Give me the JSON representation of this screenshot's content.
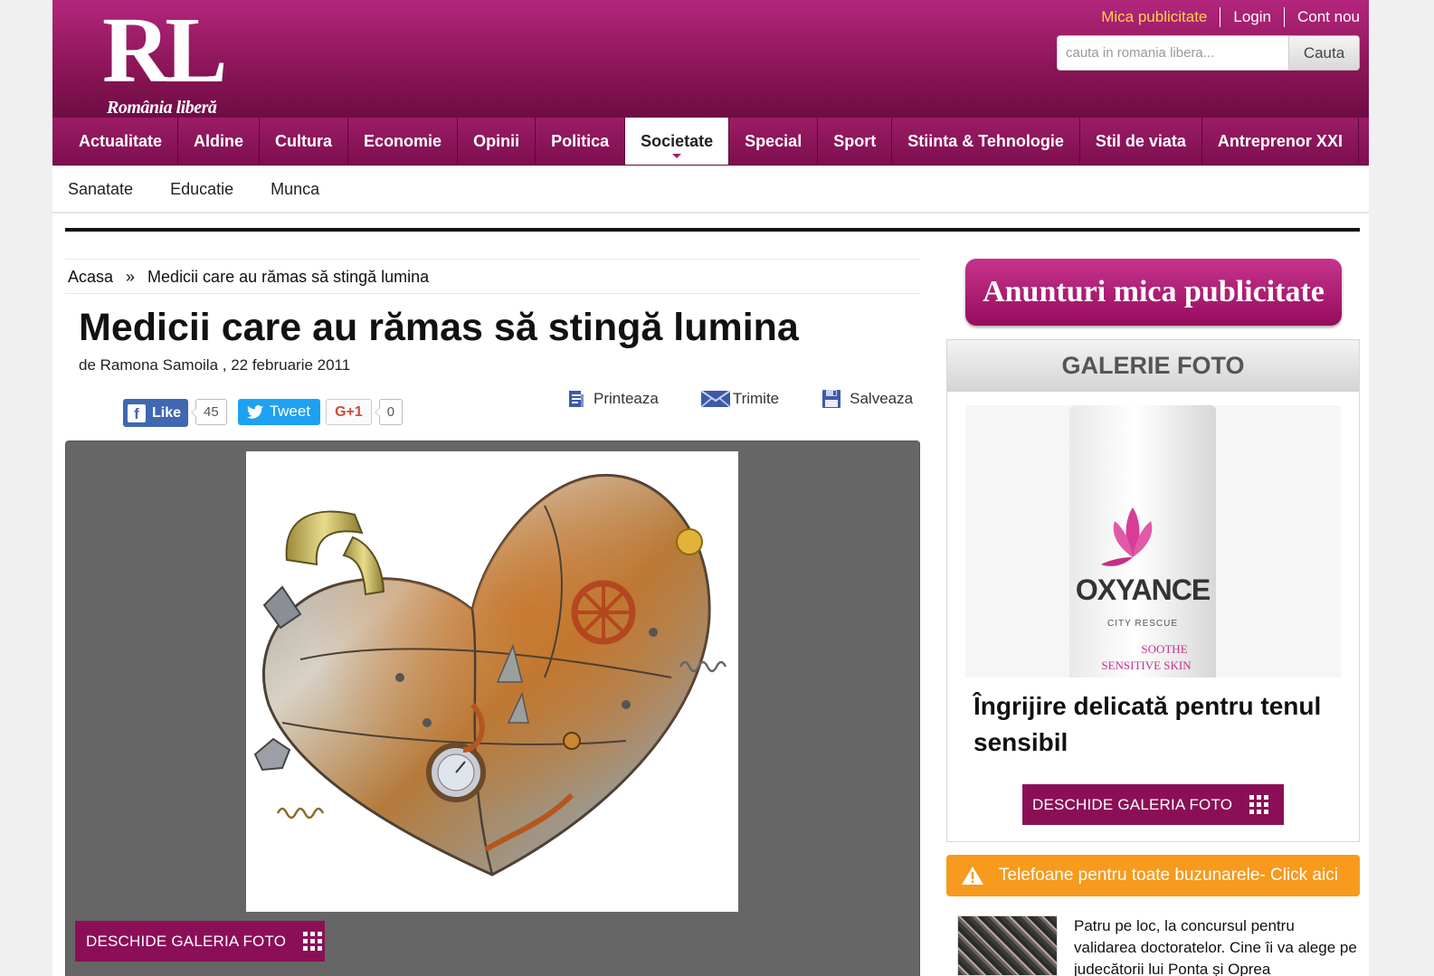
{
  "header": {
    "logo_text": "RL",
    "logo_subtitle": "România liberă",
    "top_links": [
      "Mica publicitate",
      "Login",
      "Cont nou"
    ],
    "search": {
      "placeholder": "cauta in romania libera...",
      "button": "Cauta"
    }
  },
  "nav": {
    "items": [
      "Actualitate",
      "Aldine",
      "Cultura",
      "Economie",
      "Opinii",
      "Politica",
      "Societate",
      "Special",
      "Sport",
      "Stiinta & Tehnologie",
      "Stil de viata",
      "Antreprenor XXI"
    ],
    "active": "Societate"
  },
  "subnav": {
    "items": [
      "Sanatate",
      "Educatie",
      "Munca"
    ]
  },
  "breadcrumb": {
    "home": "Acasa",
    "separator": "»",
    "current": "Medicii care au rămas să stingă lumina"
  },
  "article": {
    "title": "Medicii care au rămas să stingă lumina",
    "byline": "de Ramona Samoila , 22 februarie 2011",
    "social": {
      "like_label": "Like",
      "like_count": "45",
      "tweet_label": "Tweet",
      "gplus_label": "G+1",
      "gplus_count": "0"
    },
    "tools": {
      "print": "Printeaza",
      "send": "Trimite",
      "save": "Salveaza"
    },
    "gallery_button": "DESCHIDE GALERIA FOTO"
  },
  "sidebar": {
    "ad_banner": "Anunturi mica publicitate",
    "gallery": {
      "heading": "GALERIE FOTO",
      "product_brand": "OXYANCE",
      "product_line": "CITY RESCUE",
      "product_claim_1": "SOOTHE",
      "product_claim_2": "SENSITIVE SKIN",
      "caption": "Îngrijire delicată pentru tenul sensibil",
      "button": "DESCHIDE GALERIA FOTO"
    },
    "alert": "Telefoane pentru toate buzunarele- Click aici",
    "news_item": "Patru pe loc, la concursul pentru validarea doctoratelor. Cine îi va alege pe judecătorii lui Ponta și Oprea"
  },
  "colors": {
    "brand": "#8e1659",
    "alert": "#f79a1e",
    "facebook": "#4167b2",
    "twitter": "#1da1f2"
  }
}
